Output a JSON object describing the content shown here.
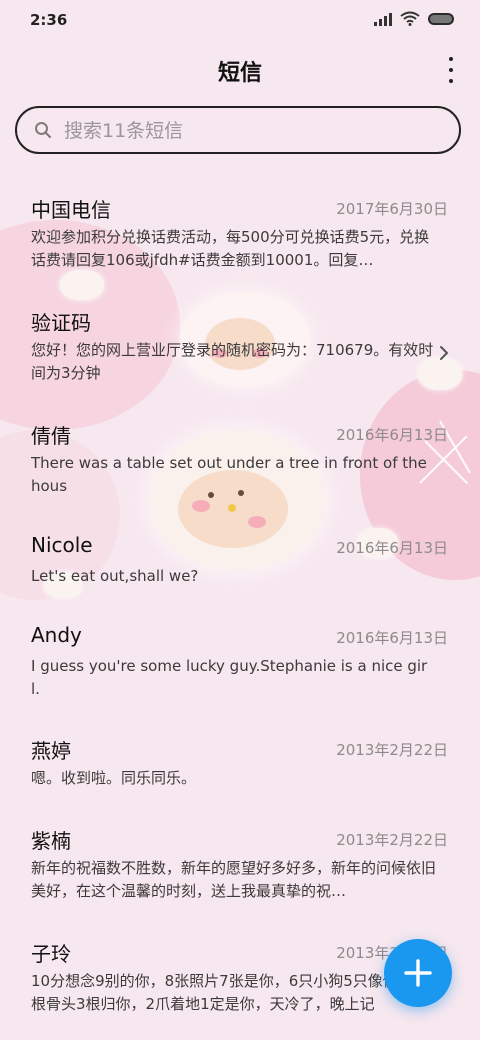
{
  "status_bar": {
    "time": "2:36",
    "icons": [
      "signal-icon",
      "wifi-icon",
      "battery-icon"
    ]
  },
  "header": {
    "title": "短信",
    "more_icon": "more-vertical-icon"
  },
  "search": {
    "placeholder": "搜索11条短信",
    "value": "",
    "icon": "search-icon"
  },
  "messages": [
    {
      "name": "中国电信",
      "date": "2017年6月30日",
      "preview": "欢迎参加积分兑换话费活动，每500分可兑换话费5元，兑换话费请回复106或jfdh#话费金额到10001。回复…"
    },
    {
      "name": "验证码",
      "date": "",
      "preview": "您好！您的网上营业厅登录的随机密码为：710679。有效时间为3分钟",
      "chevron_icon": "chevron-right-icon"
    },
    {
      "name": "倩倩",
      "date": "2016年6月13日",
      "preview": "There was a table set out under a tree in front of the hous"
    },
    {
      "name": "Nicole",
      "date": "2016年6月13日",
      "preview": "Let's eat out,shall we?"
    },
    {
      "name": "Andy",
      "date": "2016年6月13日",
      "preview": "I guess you're some lucky guy.Stephanie is a nice girl."
    },
    {
      "name": "燕婷",
      "date": "2013年2月22日",
      "preview": "嗯。收到啦。同乐同乐。"
    },
    {
      "name": "紫楠",
      "date": "2013年2月22日",
      "preview": "新年的祝福数不胜数，新年的愿望好多好多，新年的问候依旧美好，在这个温馨的时刻，送上我最真挚的祝…"
    },
    {
      "name": "子玲",
      "date": "2013年2月22日",
      "preview": "10分想念9别的你，8张照片7张是你，6只小狗5只像你，4根骨头3根归你，2爪着地1定是你，天冷了，晚上记"
    }
  ],
  "fab": {
    "icon": "plus-icon",
    "color": "#1a97ef"
  },
  "theme": {
    "background": "#f7e7ee",
    "accent": "#1a97ef"
  }
}
